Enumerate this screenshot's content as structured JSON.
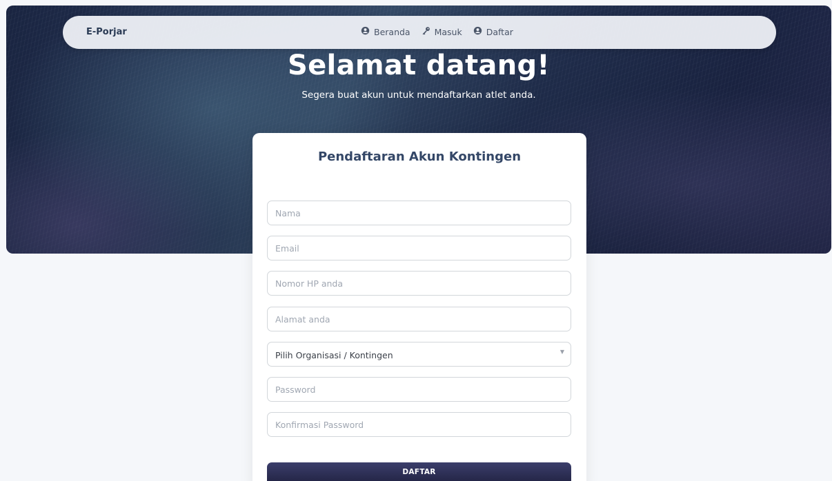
{
  "navbar": {
    "brand": "E-Porjar",
    "links": [
      {
        "label": "Beranda",
        "icon": "user-circle-icon"
      },
      {
        "label": "Masuk",
        "icon": "key-icon"
      },
      {
        "label": "Daftar",
        "icon": "user-circle-icon"
      }
    ]
  },
  "hero": {
    "title": "Selamat datang!",
    "subtitle": "Segera buat akun untuk mendaftarkan atlet anda."
  },
  "form": {
    "title": "Pendaftaran Akun Kontingen",
    "fields": {
      "nama": {
        "placeholder": "Nama",
        "value": ""
      },
      "email": {
        "placeholder": "Email",
        "value": ""
      },
      "phone": {
        "placeholder": "Nomor HP anda",
        "value": ""
      },
      "address": {
        "placeholder": "Alamat anda",
        "value": ""
      },
      "organization": {
        "selected": "Pilih Organisasi / Kontingen"
      },
      "password": {
        "placeholder": "Password",
        "value": ""
      },
      "confirm_password": {
        "placeholder": "Konfirmasi Password",
        "value": ""
      }
    },
    "submit_label": "DAFTAR"
  },
  "colors": {
    "page_background": "#f5f7fa",
    "hero_dark": "#1c2846",
    "button_dark": "#1c1d3a",
    "heading_text": "#344767"
  }
}
